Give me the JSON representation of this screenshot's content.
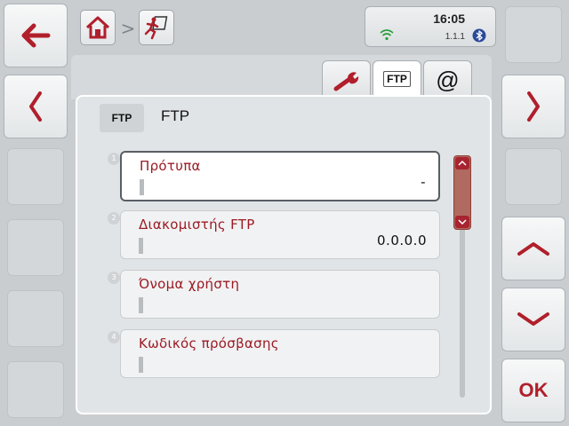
{
  "status": {
    "time": "16:05",
    "version": "1.1.1"
  },
  "tabs": [
    {
      "icon": "wrench-icon"
    },
    {
      "label": "FTP",
      "active": true
    },
    {
      "label": "@"
    }
  ],
  "panel": {
    "icon_label": "FTP",
    "title": "FTP",
    "rows": [
      {
        "num": "1",
        "label": "Πρότυπα",
        "value": "-",
        "selected": true
      },
      {
        "num": "2",
        "label": "Διακομιστής FTP",
        "value": "0.0.0.0"
      },
      {
        "num": "3",
        "label": "Όνομα χρήστη",
        "value": ""
      },
      {
        "num": "4",
        "label": "Κωδικός πρόσβασης",
        "value": ""
      }
    ]
  },
  "sidebar_right": {
    "ok_label": "OK"
  },
  "colors": {
    "accent": "#b01f2b",
    "label_text": "#9b1b24",
    "background": "#c9cdd0",
    "panel": "#e1e4e6"
  }
}
